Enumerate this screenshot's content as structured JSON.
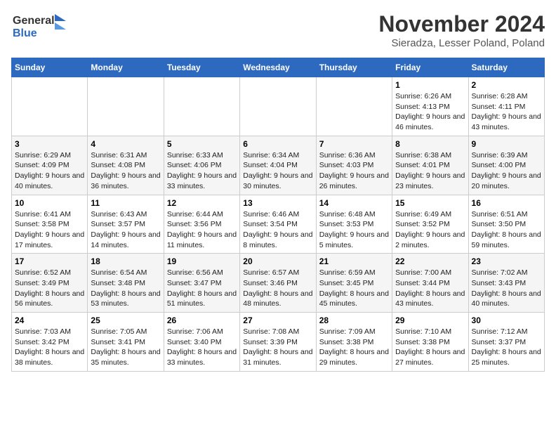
{
  "header": {
    "logo_line1": "General",
    "logo_line2": "Blue",
    "title": "November 2024",
    "subtitle": "Sieradza, Lesser Poland, Poland"
  },
  "weekdays": [
    "Sunday",
    "Monday",
    "Tuesday",
    "Wednesday",
    "Thursday",
    "Friday",
    "Saturday"
  ],
  "weeks": [
    [
      {
        "day": "",
        "info": ""
      },
      {
        "day": "",
        "info": ""
      },
      {
        "day": "",
        "info": ""
      },
      {
        "day": "",
        "info": ""
      },
      {
        "day": "",
        "info": ""
      },
      {
        "day": "1",
        "info": "Sunrise: 6:26 AM\nSunset: 4:13 PM\nDaylight: 9 hours and 46 minutes."
      },
      {
        "day": "2",
        "info": "Sunrise: 6:28 AM\nSunset: 4:11 PM\nDaylight: 9 hours and 43 minutes."
      }
    ],
    [
      {
        "day": "3",
        "info": "Sunrise: 6:29 AM\nSunset: 4:09 PM\nDaylight: 9 hours and 40 minutes."
      },
      {
        "day": "4",
        "info": "Sunrise: 6:31 AM\nSunset: 4:08 PM\nDaylight: 9 hours and 36 minutes."
      },
      {
        "day": "5",
        "info": "Sunrise: 6:33 AM\nSunset: 4:06 PM\nDaylight: 9 hours and 33 minutes."
      },
      {
        "day": "6",
        "info": "Sunrise: 6:34 AM\nSunset: 4:04 PM\nDaylight: 9 hours and 30 minutes."
      },
      {
        "day": "7",
        "info": "Sunrise: 6:36 AM\nSunset: 4:03 PM\nDaylight: 9 hours and 26 minutes."
      },
      {
        "day": "8",
        "info": "Sunrise: 6:38 AM\nSunset: 4:01 PM\nDaylight: 9 hours and 23 minutes."
      },
      {
        "day": "9",
        "info": "Sunrise: 6:39 AM\nSunset: 4:00 PM\nDaylight: 9 hours and 20 minutes."
      }
    ],
    [
      {
        "day": "10",
        "info": "Sunrise: 6:41 AM\nSunset: 3:58 PM\nDaylight: 9 hours and 17 minutes."
      },
      {
        "day": "11",
        "info": "Sunrise: 6:43 AM\nSunset: 3:57 PM\nDaylight: 9 hours and 14 minutes."
      },
      {
        "day": "12",
        "info": "Sunrise: 6:44 AM\nSunset: 3:56 PM\nDaylight: 9 hours and 11 minutes."
      },
      {
        "day": "13",
        "info": "Sunrise: 6:46 AM\nSunset: 3:54 PM\nDaylight: 9 hours and 8 minutes."
      },
      {
        "day": "14",
        "info": "Sunrise: 6:48 AM\nSunset: 3:53 PM\nDaylight: 9 hours and 5 minutes."
      },
      {
        "day": "15",
        "info": "Sunrise: 6:49 AM\nSunset: 3:52 PM\nDaylight: 9 hours and 2 minutes."
      },
      {
        "day": "16",
        "info": "Sunrise: 6:51 AM\nSunset: 3:50 PM\nDaylight: 8 hours and 59 minutes."
      }
    ],
    [
      {
        "day": "17",
        "info": "Sunrise: 6:52 AM\nSunset: 3:49 PM\nDaylight: 8 hours and 56 minutes."
      },
      {
        "day": "18",
        "info": "Sunrise: 6:54 AM\nSunset: 3:48 PM\nDaylight: 8 hours and 53 minutes."
      },
      {
        "day": "19",
        "info": "Sunrise: 6:56 AM\nSunset: 3:47 PM\nDaylight: 8 hours and 51 minutes."
      },
      {
        "day": "20",
        "info": "Sunrise: 6:57 AM\nSunset: 3:46 PM\nDaylight: 8 hours and 48 minutes."
      },
      {
        "day": "21",
        "info": "Sunrise: 6:59 AM\nSunset: 3:45 PM\nDaylight: 8 hours and 45 minutes."
      },
      {
        "day": "22",
        "info": "Sunrise: 7:00 AM\nSunset: 3:44 PM\nDaylight: 8 hours and 43 minutes."
      },
      {
        "day": "23",
        "info": "Sunrise: 7:02 AM\nSunset: 3:43 PM\nDaylight: 8 hours and 40 minutes."
      }
    ],
    [
      {
        "day": "24",
        "info": "Sunrise: 7:03 AM\nSunset: 3:42 PM\nDaylight: 8 hours and 38 minutes."
      },
      {
        "day": "25",
        "info": "Sunrise: 7:05 AM\nSunset: 3:41 PM\nDaylight: 8 hours and 35 minutes."
      },
      {
        "day": "26",
        "info": "Sunrise: 7:06 AM\nSunset: 3:40 PM\nDaylight: 8 hours and 33 minutes."
      },
      {
        "day": "27",
        "info": "Sunrise: 7:08 AM\nSunset: 3:39 PM\nDaylight: 8 hours and 31 minutes."
      },
      {
        "day": "28",
        "info": "Sunrise: 7:09 AM\nSunset: 3:38 PM\nDaylight: 8 hours and 29 minutes."
      },
      {
        "day": "29",
        "info": "Sunrise: 7:10 AM\nSunset: 3:38 PM\nDaylight: 8 hours and 27 minutes."
      },
      {
        "day": "30",
        "info": "Sunrise: 7:12 AM\nSunset: 3:37 PM\nDaylight: 8 hours and 25 minutes."
      }
    ]
  ]
}
